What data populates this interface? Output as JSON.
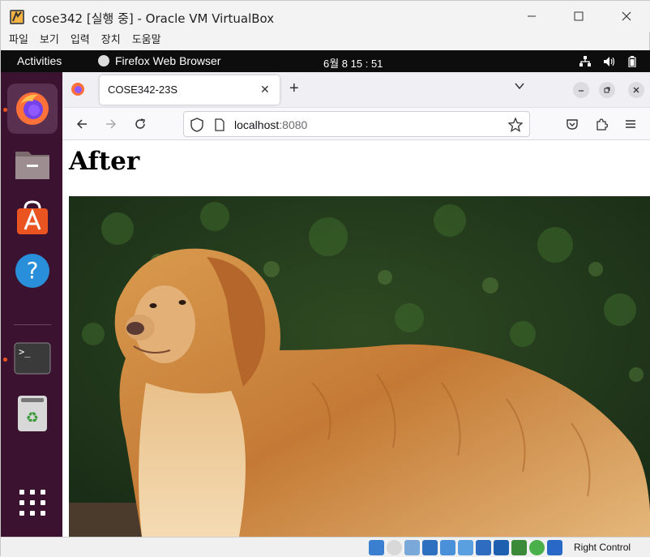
{
  "vbox": {
    "title": "cose342 [실행 중] - Oracle VM VirtualBox",
    "menu": [
      "파일",
      "보기",
      "입력",
      "장치",
      "도움말"
    ],
    "host_key": "Right Control",
    "status_icons": [
      "hard-disk-icon",
      "optical-drive-icon",
      "audio-icon",
      "network-icon",
      "usb-icon",
      "shared-folder-icon",
      "display-icon",
      "video-capture-icon",
      "cpu-icon",
      "mouse-integration-icon",
      "host-key-icon"
    ]
  },
  "gnome": {
    "activities": "Activities",
    "app_label": "Firefox Web Browser",
    "clock": "6월 8  15 : 51",
    "dock_items": [
      "firefox-icon",
      "files-icon",
      "software-icon",
      "help-icon",
      "terminal-icon",
      "trash-icon",
      "show-apps-icon"
    ]
  },
  "firefox": {
    "tab_title": "COSE342-23S",
    "url_host": "localhost",
    "url_port": ":8080"
  },
  "page": {
    "heading": "After",
    "image_subject": "golden retriever photo"
  },
  "colors": {
    "ubuntu_orange": "#e95420",
    "dock_bg": "#3b1230",
    "topbar_bg": "#0d0d0d"
  }
}
